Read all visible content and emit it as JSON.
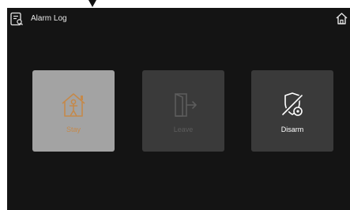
{
  "header": {
    "title": "Alarm Log",
    "log_icon": "document-search-icon",
    "home_icon": "home-icon"
  },
  "modes": [
    {
      "label": "Stay",
      "icon": "house-person-icon",
      "state": "active",
      "label_color": "#c5894a"
    },
    {
      "label": "Leave",
      "icon": "door-exit-icon",
      "state": "disabled",
      "label_color": "#5c5c5c"
    },
    {
      "label": "Disarm",
      "icon": "shield-disarm-icon",
      "state": "available",
      "label_color": "#ffffff"
    }
  ],
  "colors": {
    "screen_background": "#141414",
    "active_tile": "#a3a3a3",
    "tile": "#3a3a3a",
    "accent": "#c5894a"
  }
}
